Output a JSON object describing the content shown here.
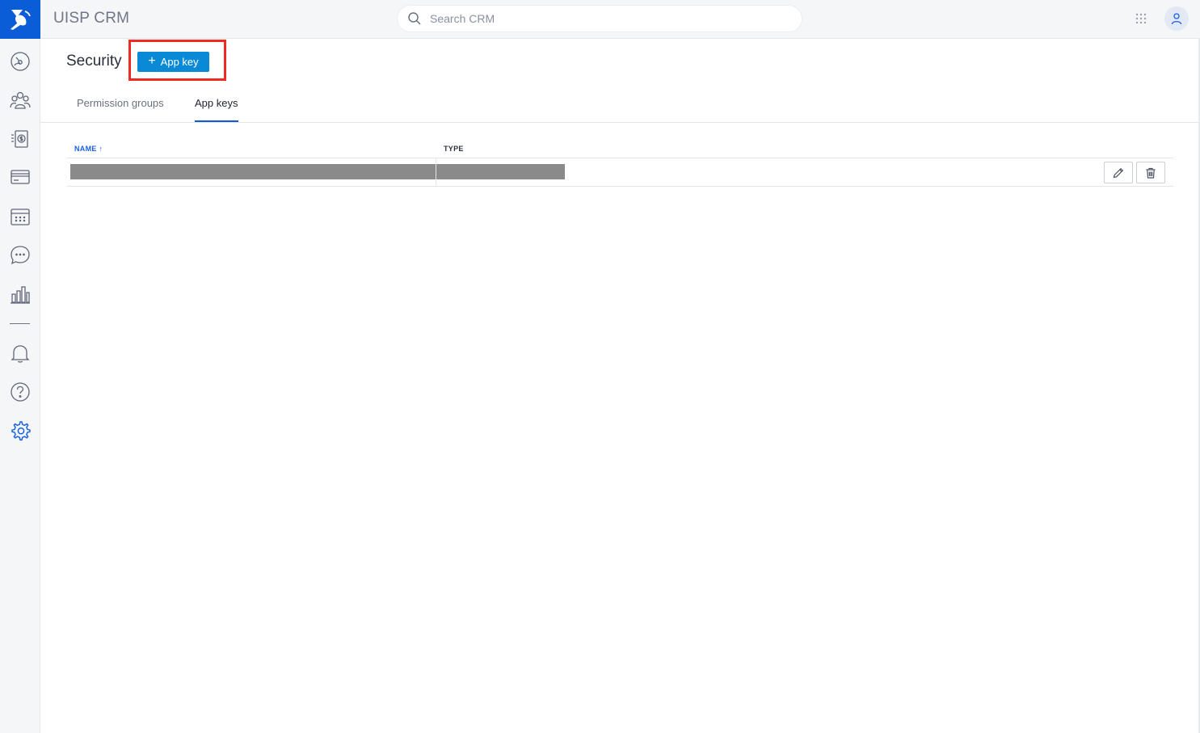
{
  "app": {
    "title": "UISP CRM"
  },
  "search": {
    "placeholder": "Search CRM",
    "value": ""
  },
  "sidebar": {
    "items": [
      {
        "name": "dashboard",
        "icon": "gauge-icon"
      },
      {
        "name": "clients",
        "icon": "users-icon"
      },
      {
        "name": "billing",
        "icon": "invoice-dollar-icon"
      },
      {
        "name": "payments",
        "icon": "credit-card-icon"
      },
      {
        "name": "scheduling",
        "icon": "calendar-icon"
      },
      {
        "name": "ticketing",
        "icon": "chat-bubble-icon"
      },
      {
        "name": "reports",
        "icon": "bar-chart-icon"
      },
      {
        "name": "notifications",
        "icon": "bell-icon"
      },
      {
        "name": "help",
        "icon": "question-icon"
      },
      {
        "name": "settings",
        "icon": "gear-icon"
      }
    ]
  },
  "page": {
    "title": "Security",
    "add_button_label": "App key"
  },
  "tabs": [
    {
      "label": "Permission groups",
      "active": false
    },
    {
      "label": "App keys",
      "active": true
    }
  ],
  "table": {
    "columns": [
      {
        "label": "NAME",
        "sort": "↑"
      },
      {
        "label": "TYPE"
      }
    ],
    "rows": [
      {
        "name": "",
        "type": ""
      }
    ]
  },
  "colors": {
    "accent": "#0b5cd7",
    "button": "#0a8ad6",
    "highlight": "#ee2a24",
    "redacted": "#8a8a8a"
  }
}
